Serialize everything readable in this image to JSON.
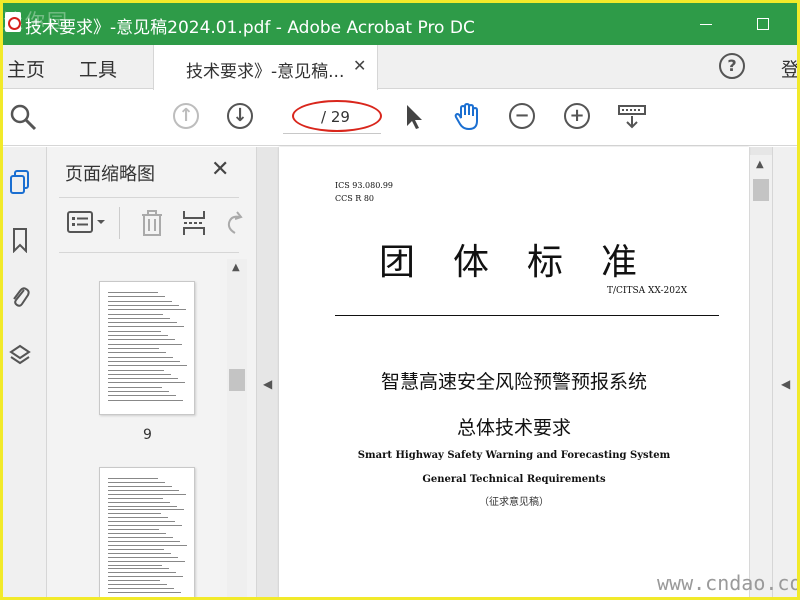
{
  "window": {
    "title": "技术要求》-意见稿2024.01.pdf - Adobe Acrobat Pro DC",
    "watermark_top": "迷你园"
  },
  "menubar": {
    "home": "主页",
    "tools": "工具",
    "doc_tab_label": "技术要求》-意见稿...",
    "doc_tab_close": "✕",
    "help": "?",
    "signin": "登"
  },
  "toolbar": {
    "page_input_value": "",
    "page_total": "/ 29",
    "icons": [
      "search-icon",
      "page-up-icon",
      "page-down-icon",
      "select-cursor-icon",
      "hand-icon",
      "zoom-out-icon",
      "zoom-in-icon",
      "read-mode-icon"
    ]
  },
  "thumbnails": {
    "panel_title": "页面缩略图",
    "close": "✕",
    "page_label": "9"
  },
  "document": {
    "ics_line": "ICS  93.080.99",
    "ccs_line": "CCS  R  80",
    "standard_heading": "团体标准",
    "standard_number": "T/CITSA  XX-202X",
    "main_title_cn": "智慧高速安全风险预警预报系统",
    "subtitle_cn": "总体技术要求",
    "title_en": "Smart Highway Safety Warning and Forecasting System",
    "subtitle_en": "General Technical Requirements",
    "draft_note": "（征求意见稿）"
  },
  "footer": {
    "site_watermark": "www.cndao.com"
  },
  "colors": {
    "titlebar": "#2e9b48",
    "frame": "#f2ea2a",
    "annotation_oval": "#d9261c",
    "hand_tool": "#1b6fd1",
    "sidebar_active_icon": "#1b6fd1"
  }
}
